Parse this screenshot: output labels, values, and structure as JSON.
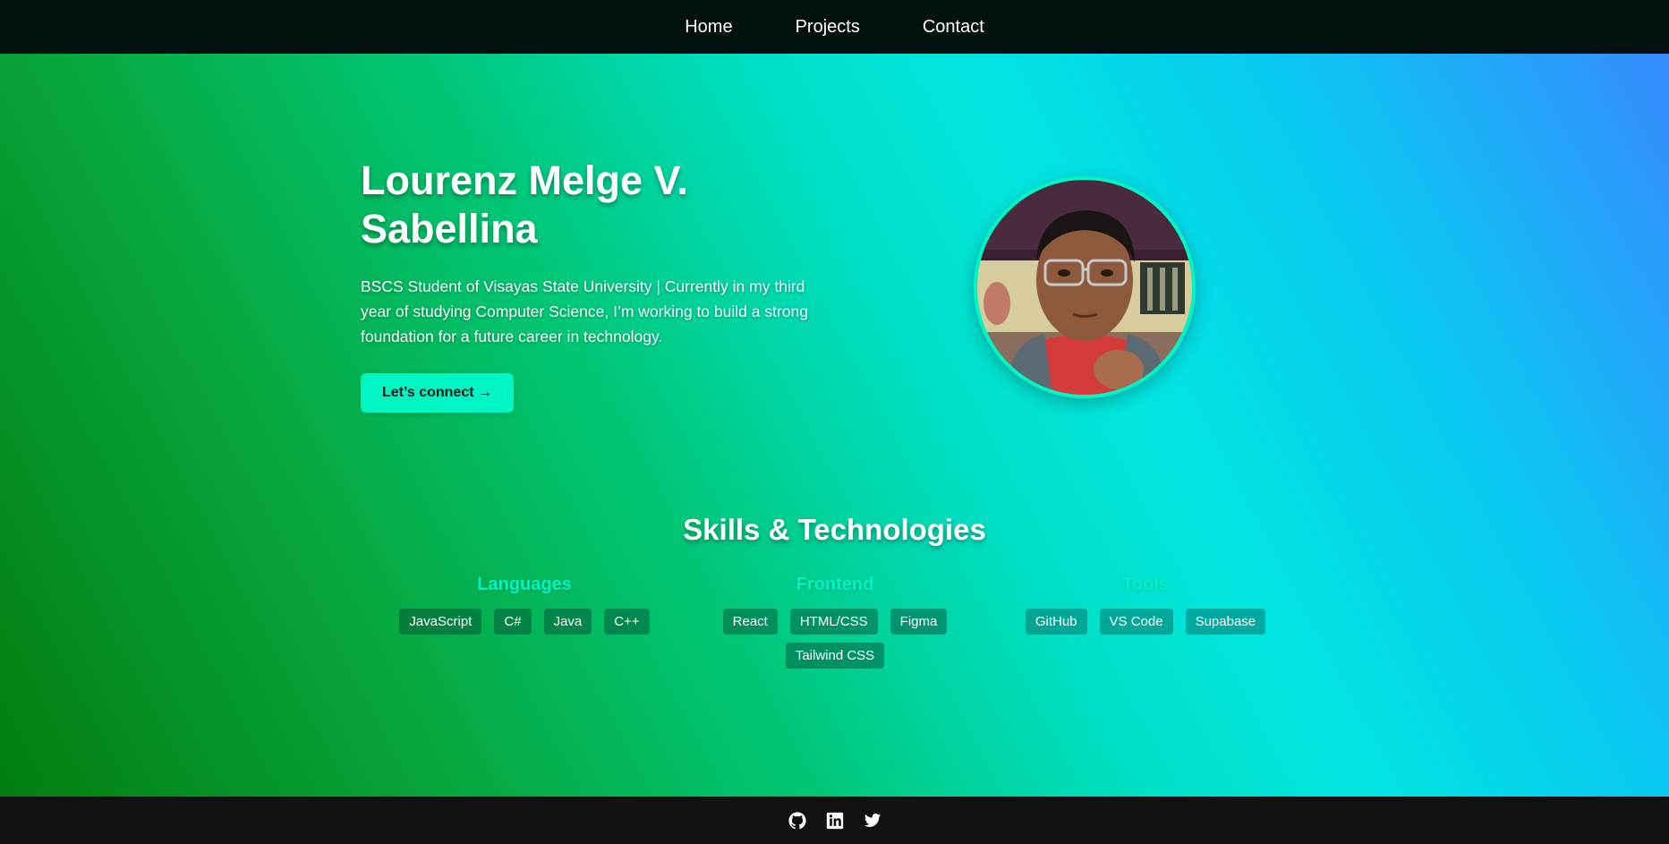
{
  "nav": {
    "items": [
      {
        "label": "Home"
      },
      {
        "label": "Projects"
      },
      {
        "label": "Contact"
      }
    ]
  },
  "hero": {
    "name": "Lourenz Melge V. Sabellina",
    "bio": "BSCS Student of Visayas State University | Currently in my third year of studying Computer Science, I’m working to build a strong foundation for a future career in technology.",
    "cta_label": "Let’s connect →",
    "avatar_icon": "profile-photo"
  },
  "skills": {
    "title": "Skills & Technologies",
    "groups": [
      {
        "title": "Languages",
        "items": [
          "JavaScript",
          "C#",
          "Java",
          "C++"
        ]
      },
      {
        "title": "Frontend",
        "items": [
          "React",
          "HTML/CSS",
          "Figma",
          "Tailwind CSS"
        ]
      },
      {
        "title": "Tools",
        "items": [
          "GitHub",
          "VS Code",
          "Supabase"
        ]
      }
    ]
  },
  "footer": {
    "icons": [
      "github-icon",
      "linkedin-icon",
      "twitter-icon"
    ]
  },
  "colors": {
    "accent": "#00f5c4",
    "navbar": "#02100f",
    "footer": "#111111"
  }
}
